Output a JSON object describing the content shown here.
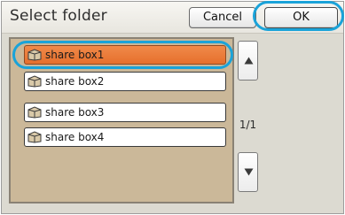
{
  "header": {
    "title": "Select folder",
    "cancel_label": "Cancel",
    "ok_label": "OK"
  },
  "folders": [
    {
      "label": "share box1",
      "selected": true,
      "icon": "folder-box-icon"
    },
    {
      "label": "share box2",
      "selected": false,
      "icon": "folder-box-icon"
    },
    {
      "label": "share box3",
      "selected": false,
      "icon": "folder-box-icon"
    },
    {
      "label": "share box4",
      "selected": false,
      "icon": "folder-box-icon"
    }
  ],
  "pagination": {
    "text": "1/1"
  },
  "scroll": {
    "up_icon": "triangle-up-icon",
    "down_icon": "triangle-down-icon"
  },
  "colors": {
    "selected_item": "#e97530",
    "list_background": "#cbb899",
    "highlight_ring": "#1aa3d9"
  }
}
